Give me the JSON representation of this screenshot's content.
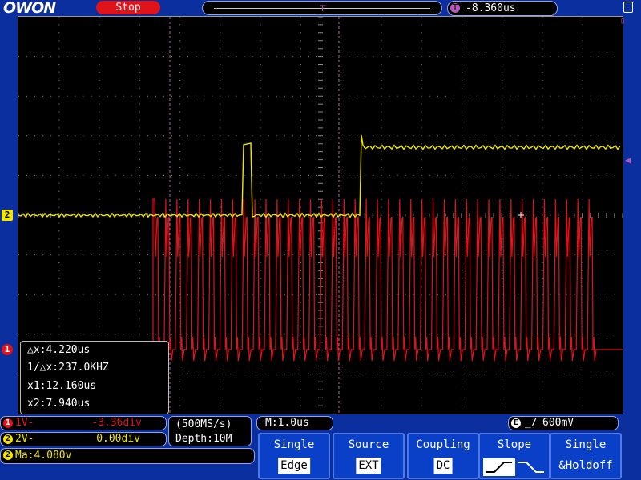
{
  "header": {
    "logo": "OWON",
    "run_status": "Stop",
    "trigger_position": "-8.360us",
    "trigger_icon": "T"
  },
  "channel_markers": {
    "ch1": "1",
    "ch2": "2"
  },
  "cursor_readout": {
    "delta_x": "△x:4.220us",
    "inverse_delta_x": "1/△x:237.0KHZ",
    "x1": "x1:12.160us",
    "x2": "x2:7.940us"
  },
  "channels": [
    {
      "badge": "1",
      "scale": "1V-",
      "offset": "-3.36div",
      "color": "#e0131a"
    },
    {
      "badge": "2",
      "scale": "2V-",
      "offset": "0.00div",
      "color": "#f2e600"
    }
  ],
  "math": {
    "badge": "2",
    "text": "Ma:4.080v"
  },
  "acquisition": {
    "sample_rate": "(500MS/s)",
    "depth": "Depth:10M"
  },
  "timebase": "M:1.0us",
  "trigger": {
    "badge": "E",
    "level": "600mV"
  },
  "softkeys": [
    {
      "title": "Single",
      "value": "Edge"
    },
    {
      "title": "Source",
      "value": "EXT"
    },
    {
      "title": "Coupling",
      "value": "DC"
    },
    {
      "title": "Slope",
      "value": ""
    },
    {
      "title": "Single",
      "value": "&Holdoff"
    }
  ],
  "colors": {
    "background": "#0b2f9e",
    "ch1": "#e0131a",
    "ch2": "#f2e600",
    "cursor": "#b45ab4",
    "grid": "#8c8c8c"
  }
}
